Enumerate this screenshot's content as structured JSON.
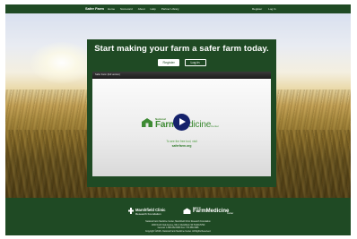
{
  "nav": {
    "brand": "Safer Farm",
    "links": [
      "Home",
      "Scorecard",
      "About",
      "Help",
      "Partner Library"
    ],
    "right_links": [
      "Register",
      "Log In"
    ]
  },
  "hero": {
    "headline": "Start making your farm a safer farm today.",
    "register_label": "Register",
    "login_label": "Log In"
  },
  "video": {
    "title": "Safer Farm (full version)",
    "logo_small": "National",
    "logo_big_a": "Farm",
    "logo_big_b": "Medicine",
    "logo_center": "Center",
    "tagline": "To see the free tool, visit",
    "site": "saferfarm.org",
    "play_icon": "play-icon"
  },
  "footer": {
    "org1_name": "Marshfield Clinic",
    "org1_sub": "Research Foundation",
    "org2_small": "National",
    "org2_big": "FarmMedicine",
    "org2_center": "Center",
    "fine_lines": [
      "National Farm Medicine Center, Marshfield Clinic Research Foundation",
      "1000 North Oak Avenue, MLC, Marshfield, WI 54449-5790",
      "General: 1-800-662-6900  Fax: 715-389-4996",
      "Copyright ©2018 • National Farm Medicine Center. All Rights Reserved."
    ]
  },
  "colors": {
    "brand_green": "#1f4a24",
    "logo_green": "#3d8a33",
    "play_blue": "#15226b"
  }
}
